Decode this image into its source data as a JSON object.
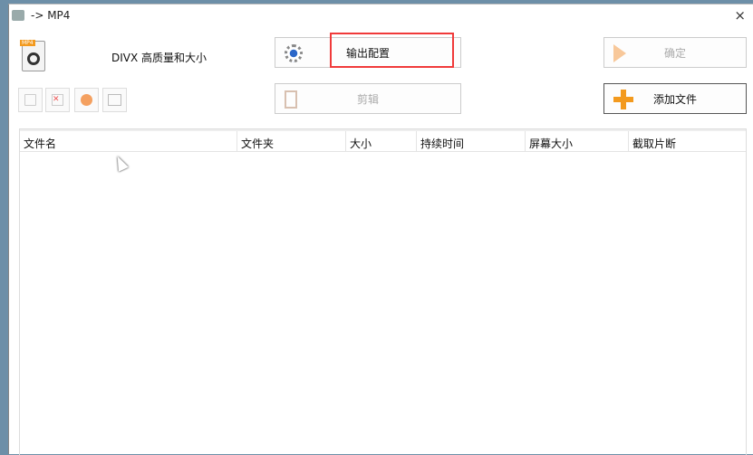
{
  "window": {
    "title": "-> MP4",
    "close": "×"
  },
  "format": {
    "label": "DIVX 高质量和大小",
    "badge": "MP4"
  },
  "buttons": {
    "output_config": "输出配置",
    "confirm": "确定",
    "edit": "剪辑",
    "add_file": "添加文件"
  },
  "table": {
    "columns": [
      "文件名",
      "文件夹",
      "大小",
      "持续时间",
      "屏幕大小",
      "截取片断"
    ],
    "rows": []
  },
  "colors": {
    "highlight": "#f03a3a",
    "accent": "#f39a1e"
  }
}
